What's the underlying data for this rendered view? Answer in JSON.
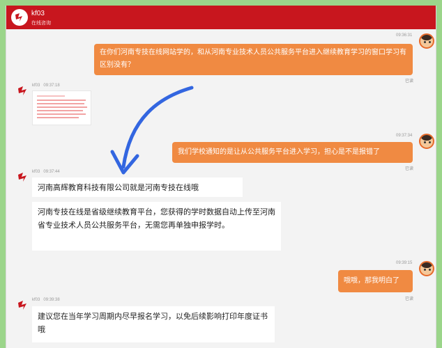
{
  "header": {
    "name": "kf03",
    "status": "在线咨询"
  },
  "messages": [
    {
      "from": "user",
      "time": "09:36:31",
      "text": "在你们河南专技在线网站学的，和从河南专业技术人员公共服务平台进入继续教育学习的窗口学习有区别没有？",
      "status": "已读"
    },
    {
      "from": "kf",
      "name": "kf03",
      "time": "09:37:18",
      "type": "image"
    },
    {
      "from": "user",
      "time": "09:37:34",
      "text": "我们学校通知的是让从公共服务平台进入学习，担心是不是报错了",
      "status": "已读"
    },
    {
      "from": "kf",
      "name": "kf03",
      "time": "09:37:44",
      "texts": [
        "河南高辉教育科技有限公司就是河南专技在线哦",
        "河南专技在线是省级继续教育平台，您获得的学时数据自动上传至河南省专业技术人员公共服务平台，无需您再单独申报学时。"
      ]
    },
    {
      "from": "user",
      "time": "09:39:15",
      "text": "哦哦，那我明白了",
      "status": "已读"
    },
    {
      "from": "kf",
      "name": "kf03",
      "time": "09:39:38",
      "texts": [
        "建议您在当年学习周期内尽早报名学习，以免后续影响打印年度证书哦"
      ]
    }
  ],
  "colors": {
    "header": "#c8161e",
    "user_bubble": "#f08a42",
    "arrow": "#3366e0",
    "border": "#9bd58a"
  },
  "icons": [
    "logo-icon",
    "user-avatar-icon",
    "kf-avatar-icon",
    "curved-arrow-icon"
  ]
}
